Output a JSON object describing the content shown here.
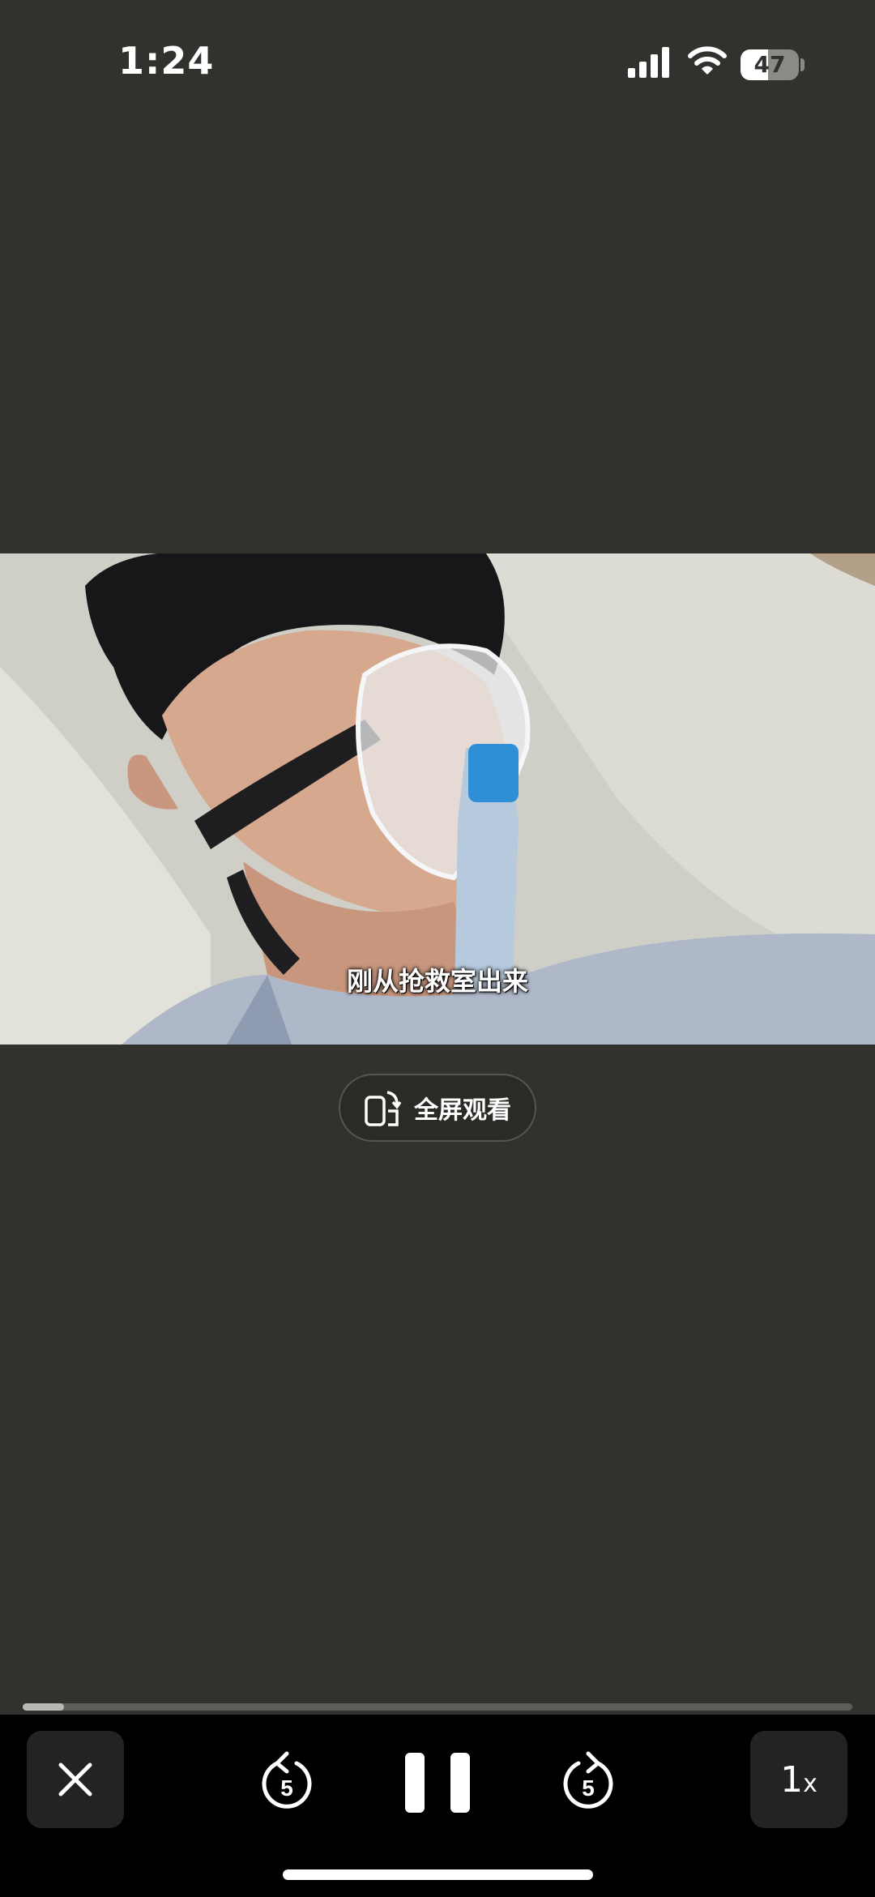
{
  "status_bar": {
    "time": "1:24",
    "battery_level": "47",
    "battery_fraction": 0.47
  },
  "video": {
    "subtitle": "刚从抢救室出来"
  },
  "fullscreen": {
    "label": "全屏观看",
    "icon": "rotate-phone-icon"
  },
  "playback": {
    "progress_fraction": 0.05,
    "rewind_seconds": "5",
    "forward_seconds": "5",
    "speed_value": "1",
    "speed_suffix": "x"
  },
  "colors": {
    "background": "#32312d",
    "control_bar": "#000000",
    "button_bg": "#232323",
    "progress_track": "#5e5d59",
    "progress_fill": "#b9b8b3"
  }
}
